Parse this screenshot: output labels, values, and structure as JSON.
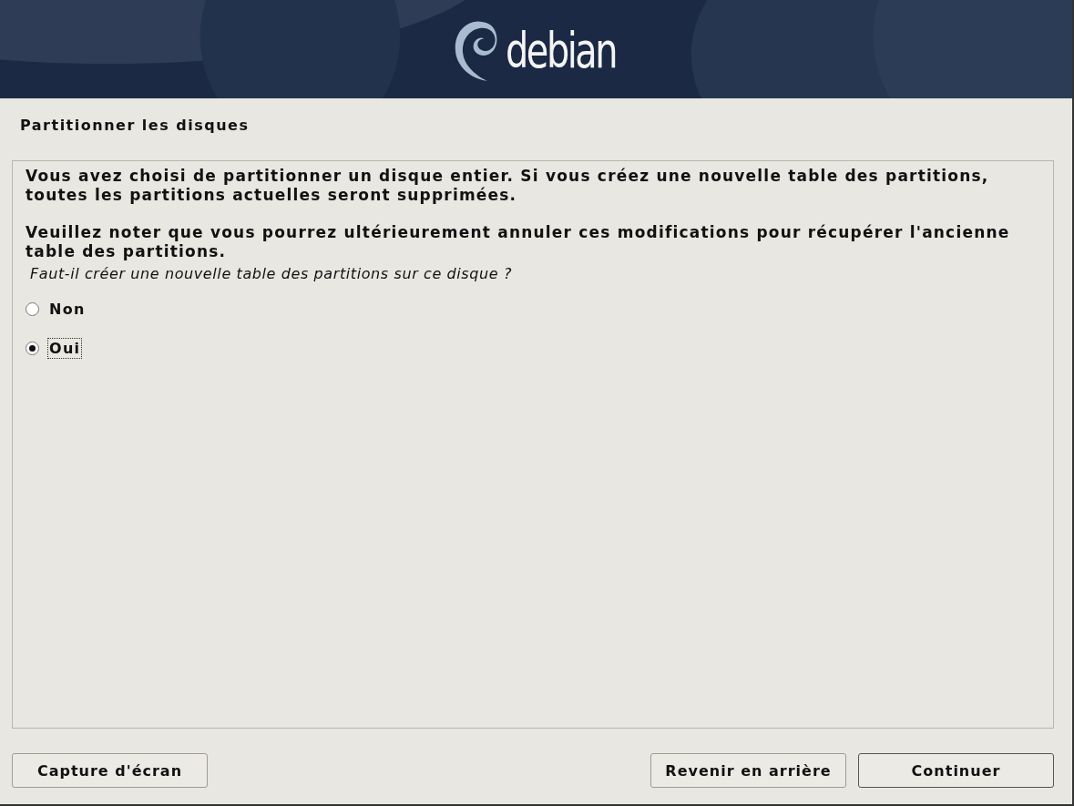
{
  "banner": {
    "logo_text": "debian"
  },
  "title": "Partitionner les disques",
  "paragraphs": [
    "Vous avez choisi de partitionner un disque entier. Si vous créez une nouvelle table des partitions, toutes les partitions actuelles seront supprimées.",
    "Veuillez noter que vous pourrez ultérieurement annuler ces modifications pour récupérer l'ancienne table des partitions."
  ],
  "question": "Faut-il créer une nouvelle table des partitions sur ce disque ?",
  "options": [
    {
      "label": "Non",
      "selected": false
    },
    {
      "label": "Oui",
      "selected": true
    }
  ],
  "buttons": {
    "left": [
      {
        "label": "Capture d'écran",
        "default": false
      }
    ],
    "right": [
      {
        "label": "Revenir en arrière",
        "default": false
      },
      {
        "label": "Continuer",
        "default": true
      }
    ]
  }
}
